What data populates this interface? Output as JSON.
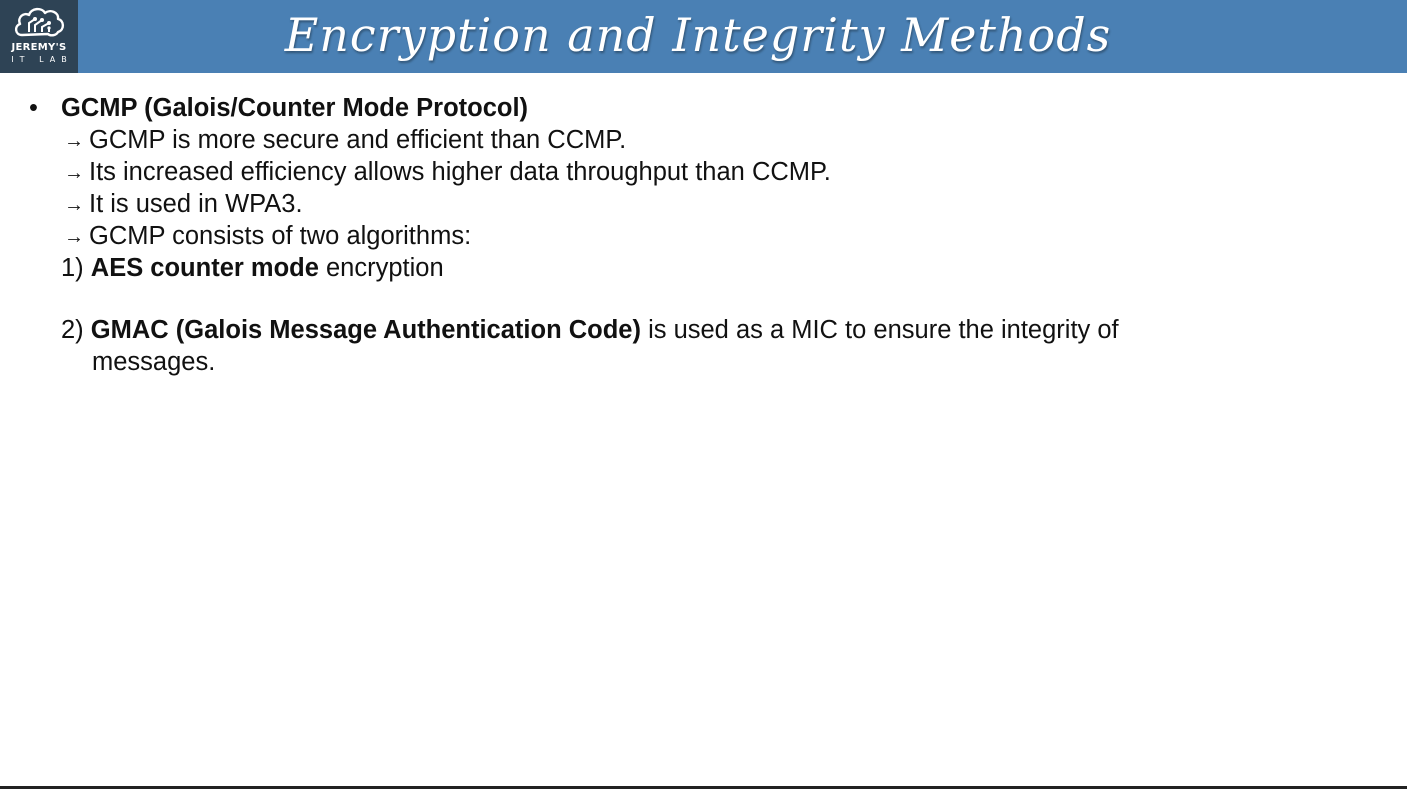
{
  "header": {
    "title": "Encryption and Integrity Methods",
    "logo_line1": "JEREMY'S",
    "logo_line2": "IT LAB",
    "background_color": "#4a80b4",
    "logo_background_color": "#2e4355"
  },
  "content": {
    "bullet": {
      "marker": "•",
      "heading": "GCMP (Galois/Counter Mode Protocol)"
    },
    "arrow_symbol": "→",
    "points": [
      "GCMP is more secure and efficient than CCMP.",
      "Its increased efficiency allows higher data throughput than CCMP.",
      "It is used in WPA3.",
      "GCMP consists of two algorithms:"
    ],
    "algorithms": [
      {
        "number": "1)",
        "bold": "AES counter mode",
        "rest": " encryption"
      },
      {
        "number": "2)",
        "bold": "GMAC (Galois Message Authentication Code)",
        "rest": " is used as a MIC to ensure the integrity of",
        "continuation": "messages."
      }
    ]
  }
}
